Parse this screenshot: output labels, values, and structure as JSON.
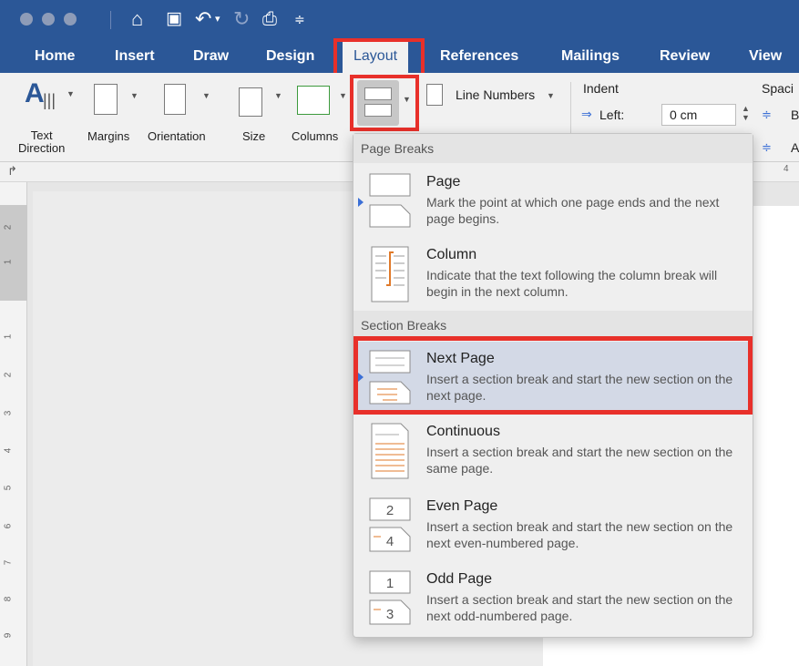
{
  "tabs": [
    "Home",
    "Insert",
    "Draw",
    "Design",
    "Layout",
    "References",
    "Mailings",
    "Review",
    "View"
  ],
  "active_tab": "Layout",
  "ribbon": {
    "text_direction": "Text\nDirection",
    "margins": "Margins",
    "orientation": "Orientation",
    "size": "Size",
    "columns": "Columns",
    "line_numbers": "Line Numbers",
    "indent": "Indent",
    "left_label": "Left:",
    "left_value": "0 cm",
    "spacing": "Spaci",
    "before_short": "B",
    "after_short": "A"
  },
  "ruler_mark": "4",
  "left_ruler_numbers": [
    "2",
    "1",
    "1",
    "2",
    "3",
    "4",
    "5",
    "6",
    "7",
    "8",
    "9"
  ],
  "menu": {
    "page_breaks_header": "Page Breaks",
    "section_breaks_header": "Section Breaks",
    "page": {
      "title": "Page",
      "desc": "Mark the point at which one page ends and the next page begins."
    },
    "column": {
      "title": "Column",
      "desc": "Indicate that the text following the column break will begin in the next column."
    },
    "next_page": {
      "title": "Next Page",
      "desc": "Insert a section break and start the new section on the next page."
    },
    "continuous": {
      "title": "Continuous",
      "desc": "Insert a section break and start the new section on the same page."
    },
    "even_page": {
      "title": "Even Page",
      "desc": "Insert a section break and start the new section on the next even-numbered page."
    },
    "odd_page": {
      "title": "Odd Page",
      "desc": "Insert a section break and start the new section on the next odd-numbered page."
    },
    "even_icon_top": "2",
    "even_icon_bottom": "4",
    "odd_icon_top": "1",
    "odd_icon_bottom": "3"
  }
}
